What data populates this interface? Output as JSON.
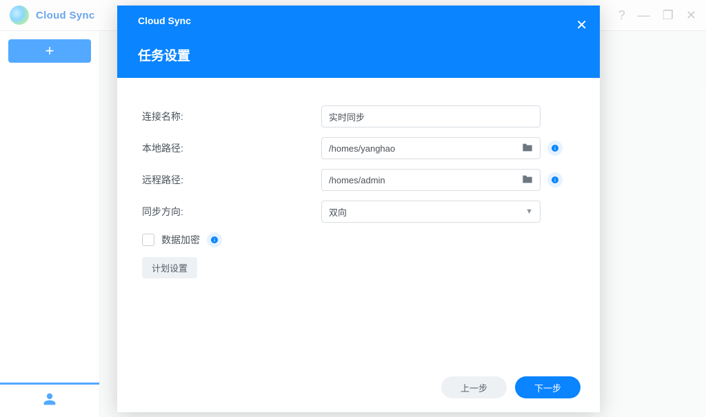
{
  "bg": {
    "title": "Cloud Sync"
  },
  "modal": {
    "headerTitle": "Cloud Sync",
    "headerSub": "任务设置",
    "labels": {
      "connectionName": "连接名称:",
      "localPath": "本地路径:",
      "remotePath": "远程路径:",
      "syncDirection": "同步方向:",
      "encryption": "数据加密",
      "schedule": "计划设置"
    },
    "values": {
      "connectionName": "实时同步",
      "localPath": "/homes/yanghao",
      "remotePath": "/homes/admin",
      "syncDirection": "双向"
    },
    "buttons": {
      "prev": "上一步",
      "next": "下一步"
    }
  }
}
